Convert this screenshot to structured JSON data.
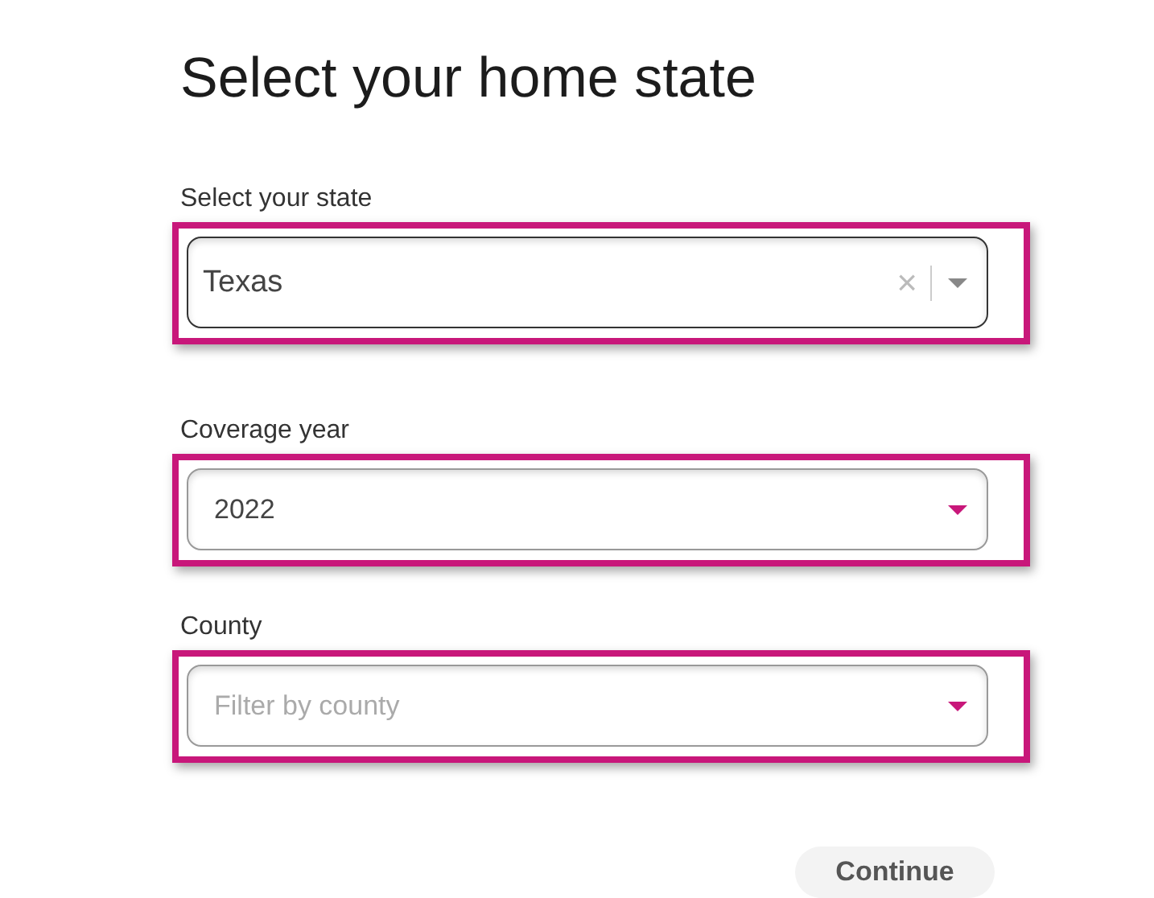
{
  "title": "Select your home state",
  "fields": [
    {
      "label": "Select your state",
      "kind": "clearable",
      "value": "Texas",
      "clear": "×",
      "highlighted": true
    },
    {
      "label": "Coverage year",
      "kind": "dropdown",
      "value": "2022",
      "highlighted": true
    },
    {
      "label": "County",
      "kind": "dropdown",
      "placeholder": "Filter by county",
      "highlighted": true
    }
  ],
  "button": "Continue"
}
